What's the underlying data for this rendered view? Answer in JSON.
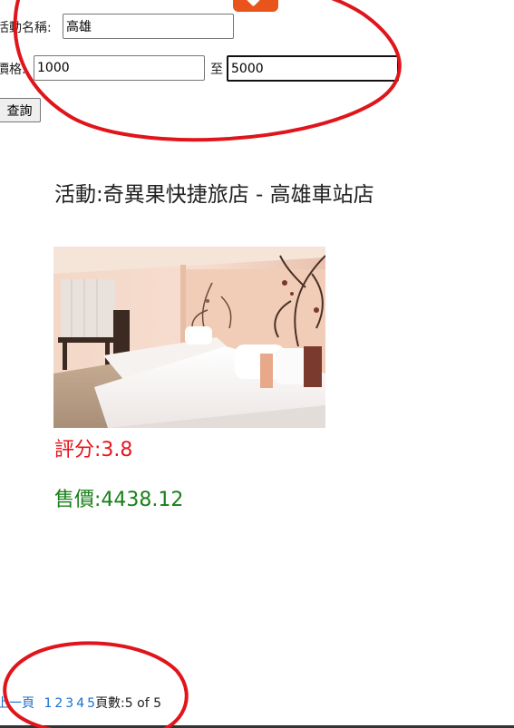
{
  "form": {
    "activity_label": "活動名稱:",
    "activity_value": "高雄",
    "price_label": "價格:",
    "price_min": "1000",
    "range_separator": "至",
    "price_max": "5000",
    "query_button": "查詢"
  },
  "result": {
    "title": "活動:奇異果快捷旅店 - 高雄車站店",
    "rating_text": "評分:3.8",
    "price_text": "售價:4438.12"
  },
  "pagination": {
    "prev_label": "上一頁",
    "pages": [
      "1",
      "2",
      "3",
      "4",
      "5"
    ],
    "summary": "頁數:5 of 5"
  },
  "colors": {
    "rating": "#e8141b",
    "price": "#188018",
    "link": "#1a6fd0",
    "annotation_circle": "#e0151b",
    "badge": "#e8541c"
  },
  "icons": {
    "badge": "chevron-down-icon",
    "photo": "hotel-room-photo"
  }
}
